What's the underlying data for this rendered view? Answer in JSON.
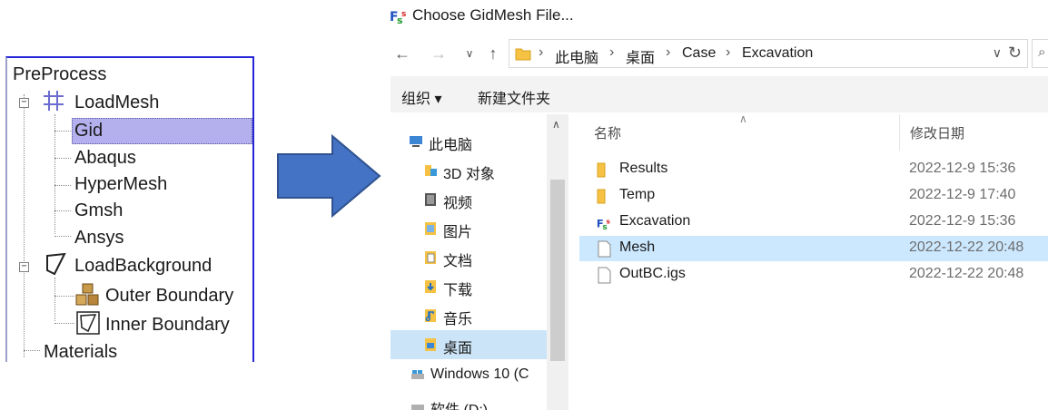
{
  "tree": {
    "root": "PreProcess",
    "loadmesh": "LoadMesh",
    "mesh_items": [
      "Gid",
      "Abaqus",
      "HyperMesh",
      "Gmsh",
      "Ansys"
    ],
    "loadbackground": "LoadBackground",
    "background_items": [
      "Outer Boundary",
      "Inner Boundary"
    ],
    "materials": "Materials",
    "selected_item": "Gid",
    "highlight_color": "#b4b0ee"
  },
  "arrow": {
    "color": "#4472c4"
  },
  "dialog": {
    "title": "Choose GidMesh File...",
    "breadcrumbs": [
      "此电脑",
      "桌面",
      "Case",
      "Excavation"
    ],
    "commands": {
      "organize": "组织 ▾",
      "new_folder": "新建文件夹"
    },
    "nav_items": [
      {
        "label": "此电脑",
        "icon": "computer-icon"
      },
      {
        "label": "3D 对象",
        "icon": "3d-objects-icon"
      },
      {
        "label": "视频",
        "icon": "video-icon"
      },
      {
        "label": "图片",
        "icon": "pictures-icon"
      },
      {
        "label": "文档",
        "icon": "documents-icon"
      },
      {
        "label": "下载",
        "icon": "download-icon"
      },
      {
        "label": "音乐",
        "icon": "music-icon"
      },
      {
        "label": "桌面",
        "icon": "desktop-icon"
      },
      {
        "label": "Windows 10 (C",
        "icon": "drive-icon"
      },
      {
        "label": "软件 (D:)",
        "icon": "drive-icon"
      }
    ],
    "selected_nav": "桌面",
    "columns": {
      "name": "名称",
      "modified": "修改日期"
    },
    "files": [
      {
        "name": "Results",
        "date": "2022-12-9 15:36",
        "icon": "folder-icon"
      },
      {
        "name": "Temp",
        "date": "2022-12-9 17:40",
        "icon": "folder-icon"
      },
      {
        "name": "Excavation",
        "date": "2022-12-9 15:36",
        "icon": "app-logo-icon"
      },
      {
        "name": "Mesh",
        "date": "2022-12-22 20:48",
        "icon": "file-icon"
      },
      {
        "name": "OutBC.igs",
        "date": "2022-12-22 20:48",
        "icon": "file-icon"
      }
    ],
    "selected_file": "Mesh",
    "selection_color": "#cce8ff"
  }
}
